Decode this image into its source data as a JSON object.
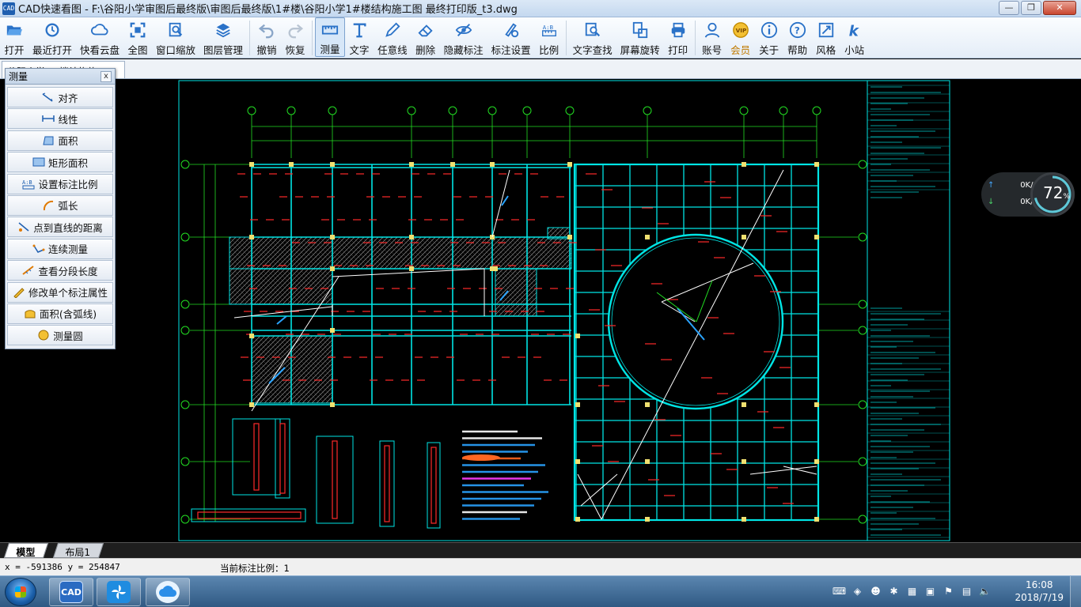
{
  "window": {
    "logo_text": "CAD",
    "title": "CAD快速看图 - F:\\谷阳小学审图后最终版\\审图后最终版\\1#楼\\谷阳小学1#楼结构施工图 最终打印版_t3.dwg",
    "minimize": "—",
    "maximize": "❐",
    "close": "✕"
  },
  "toolbar": {
    "items": [
      {
        "label": "打开",
        "icon": "folder-open-icon"
      },
      {
        "label": "最近打开",
        "icon": "recent-icon"
      },
      {
        "label": "快看云盘",
        "icon": "cloud-icon"
      },
      {
        "label": "全图",
        "icon": "fit-all-icon"
      },
      {
        "label": "窗口缩放",
        "icon": "zoom-window-icon"
      },
      {
        "label": "图层管理",
        "icon": "layers-icon"
      },
      {
        "label": "撤销",
        "icon": "undo-icon"
      },
      {
        "label": "恢复",
        "icon": "redo-icon"
      },
      {
        "label": "测量",
        "icon": "measure-icon"
      },
      {
        "label": "文字",
        "icon": "text-icon"
      },
      {
        "label": "任意线",
        "icon": "pen-icon"
      },
      {
        "label": "删除",
        "icon": "eraser-icon"
      },
      {
        "label": "隐藏标注",
        "icon": "hide-icon"
      },
      {
        "label": "标注设置",
        "icon": "annotation-settings-icon"
      },
      {
        "label": "比例",
        "icon": "scale-icon"
      },
      {
        "label": "文字查找",
        "icon": "text-search-icon"
      },
      {
        "label": "屏幕旋转",
        "icon": "rotate-screen-icon"
      },
      {
        "label": "打印",
        "icon": "print-icon"
      },
      {
        "label": "账号",
        "icon": "account-icon"
      },
      {
        "label": "会员",
        "icon": "vip-icon"
      },
      {
        "label": "关于",
        "icon": "info-icon"
      },
      {
        "label": "帮助",
        "icon": "help-icon"
      },
      {
        "label": "风格",
        "icon": "style-icon"
      },
      {
        "label": "小站",
        "icon": "station-icon"
      }
    ],
    "active": "测量"
  },
  "doc_tab": {
    "label": "谷阳小学1#楼结构施工"
  },
  "measure_panel": {
    "title": "测量",
    "close": "x",
    "items": [
      {
        "label": "对齐",
        "icon": "align-measure-icon"
      },
      {
        "label": "线性",
        "icon": "linear-measure-icon"
      },
      {
        "label": "面积",
        "icon": "area-icon"
      },
      {
        "label": "矩形面积",
        "icon": "rect-area-icon"
      },
      {
        "label": "设置标注比例",
        "icon": "set-scale-icon"
      },
      {
        "label": "弧长",
        "icon": "arc-length-icon"
      },
      {
        "label": "点到直线的距离",
        "icon": "point-line-distance-icon"
      },
      {
        "label": "连续测量",
        "icon": "continuous-measure-icon"
      },
      {
        "label": "查看分段长度",
        "icon": "segment-length-icon"
      },
      {
        "label": "修改单个标注属性",
        "icon": "edit-annotation-icon"
      },
      {
        "label": "面积(含弧线)",
        "icon": "area-arc-icon"
      },
      {
        "label": "测量圆",
        "icon": "measure-circle-icon"
      }
    ]
  },
  "net_widget": {
    "up": "0K/s",
    "down": "0K/s",
    "percent": "72",
    "percent_unit": "%"
  },
  "layout_tabs": [
    {
      "label": "模型",
      "active": true
    },
    {
      "label": "布局1",
      "active": false
    }
  ],
  "status": {
    "coordinates": "x = -591386  y = 254847",
    "scale": "当前标注比例：1"
  },
  "taskbar": {
    "apps": [
      {
        "name": "cad-app",
        "text": "CAD"
      },
      {
        "name": "pinwheel-app",
        "text": ""
      },
      {
        "name": "cloud-app",
        "text": ""
      }
    ],
    "time": "16:08",
    "date": "2018/7/19"
  },
  "colors": {
    "grid_cyan": "#00e5e5",
    "grid_green": "#22dd22",
    "dim_red": "#ff2a2a",
    "hatch": "#7a7a7a",
    "background": "#000000",
    "accent": "#1f5fb0"
  }
}
